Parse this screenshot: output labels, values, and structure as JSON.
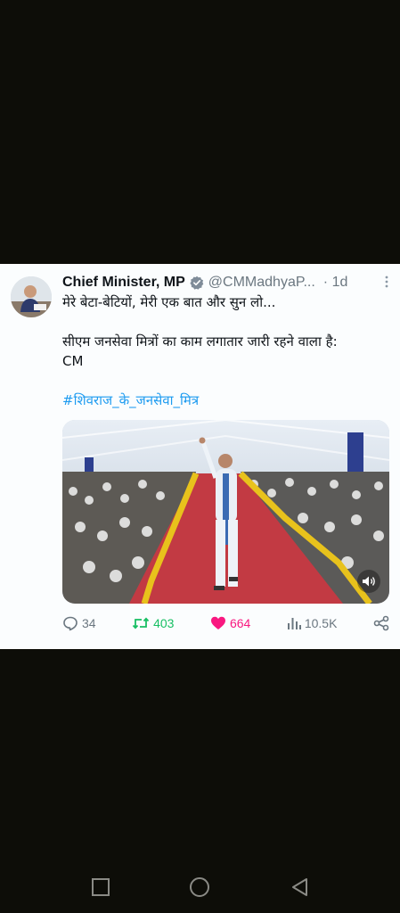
{
  "tweet": {
    "author_name": "Chief Minister, MP",
    "handle": "@CMMadhyaP...",
    "time": "· 1d",
    "lines": [
      "मेरे बेटा-बेटियों, मेरी एक बात और सुन लो...",
      "सीएम जनसेवा मित्रों का काम लगातार जारी रहने वाला है:",
      "CM"
    ],
    "hashtag": "#शिवराज_के_जनसेवा_मित्र",
    "actions": {
      "replies": "34",
      "retweets": "403",
      "likes": "664",
      "views": "10.5K"
    }
  },
  "colors": {
    "accent": "#1d9bf0",
    "retweet": "#17bf63",
    "like": "#f91880",
    "muted": "#6b7780",
    "background": "#0d0d08"
  },
  "icons": [
    "verified-badge-icon",
    "more-options-icon",
    "reply-icon",
    "retweet-icon",
    "like-icon",
    "views-icon",
    "share-icon",
    "volume-icon",
    "nav-square-icon",
    "nav-circle-icon",
    "nav-back-icon"
  ]
}
